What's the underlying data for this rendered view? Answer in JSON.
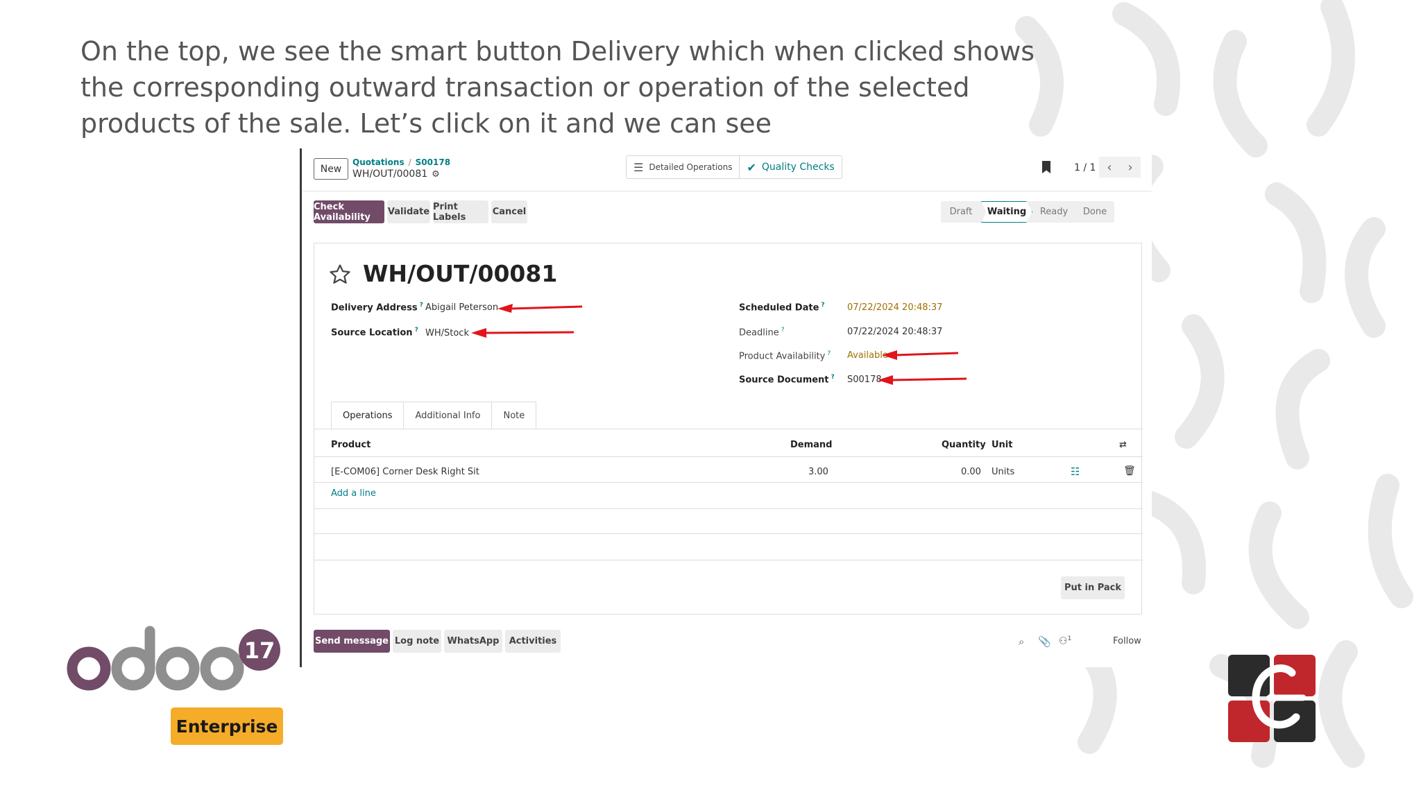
{
  "caption": "On the top, we see the smart button Delivery which when clicked shows the corresponding outward transaction or operation of the selected products of the sale. Let’s click on it and we can see",
  "header": {
    "new_label": "New",
    "breadcrumb": [
      "Quotations",
      "S00178"
    ],
    "current": "WH/OUT/00081",
    "smart_buttons": [
      "Detailed Operations",
      "Quality Checks"
    ],
    "pager": "1 / 1"
  },
  "actions": [
    "Check Availability",
    "Validate",
    "Print Labels",
    "Cancel"
  ],
  "statusbar": {
    "steps": [
      "Draft",
      "Waiting",
      "Ready",
      "Done"
    ],
    "active": "Waiting"
  },
  "record": {
    "title": "WH/OUT/00081",
    "fields_left": [
      {
        "label": "Delivery Address",
        "value": "Abigail Peterson"
      },
      {
        "label": "Source Location",
        "value": "WH/Stock"
      }
    ],
    "fields_right": [
      {
        "label": "Scheduled Date",
        "value": "07/22/2024 20:48:37"
      },
      {
        "label": "Deadline",
        "value": "07/22/2024 20:48:37"
      },
      {
        "label": "Product Availability",
        "value": "Available"
      },
      {
        "label": "Source Document",
        "value": "S00178"
      }
    ],
    "help_mark": "?"
  },
  "tabs": [
    "Operations",
    "Additional Info",
    "Note"
  ],
  "table": {
    "headers": {
      "product": "Product",
      "demand": "Demand",
      "quantity": "Quantity",
      "unit": "Unit"
    },
    "rows": [
      {
        "product": "[E-COM06] Corner Desk Right Sit",
        "demand": "3.00",
        "quantity": "0.00",
        "unit": "Units"
      }
    ],
    "add_line": "Add a line"
  },
  "put_in_pack": "Put in Pack",
  "chatter": {
    "buttons": [
      "Send message",
      "Log note",
      "WhatsApp",
      "Activities"
    ],
    "follower_count": "1",
    "follow": "Follow"
  },
  "branding": {
    "version": "17",
    "edition": "Enterprise"
  },
  "colors": {
    "odoo_purple": "#714b67",
    "teal": "#017e84",
    "gold": "#a07000",
    "badge": "#f5ac28",
    "arrow": "#e0141b"
  }
}
